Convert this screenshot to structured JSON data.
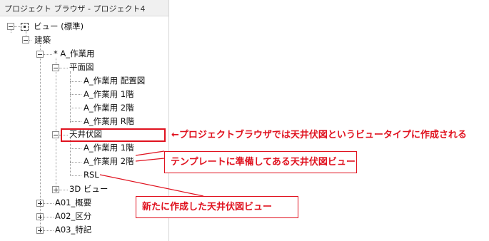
{
  "window": {
    "title": "プロジェクト ブラウザ - プロジェクト4"
  },
  "tree": {
    "root": "ビュー (標準)",
    "discipline": "建築",
    "subgroup": "* A_作業用",
    "floor_plan": "平面図",
    "floor_plan_items": [
      "A_作業用 配置図",
      "A_作業用 1階",
      "A_作業用 2階",
      "A_作業用 R階"
    ],
    "ceiling_plan": "天井伏図",
    "ceiling_plan_items": [
      "A_作業用 1階",
      "A_作業用 2階",
      "RSL"
    ],
    "view_3d": "3D ビュー",
    "groups": [
      "A01_概要",
      "A02_区分",
      "A03_特記"
    ]
  },
  "annotations": {
    "arrow_note": "←プロジェクトブラウザでは天井伏図というビュータイプに作成される",
    "template_note": "テンプレートに準備してある天井伏図ビュー",
    "new_note": "新たに作成した天井伏図ビュー"
  },
  "colors": {
    "accent_red": "#e0121f"
  }
}
